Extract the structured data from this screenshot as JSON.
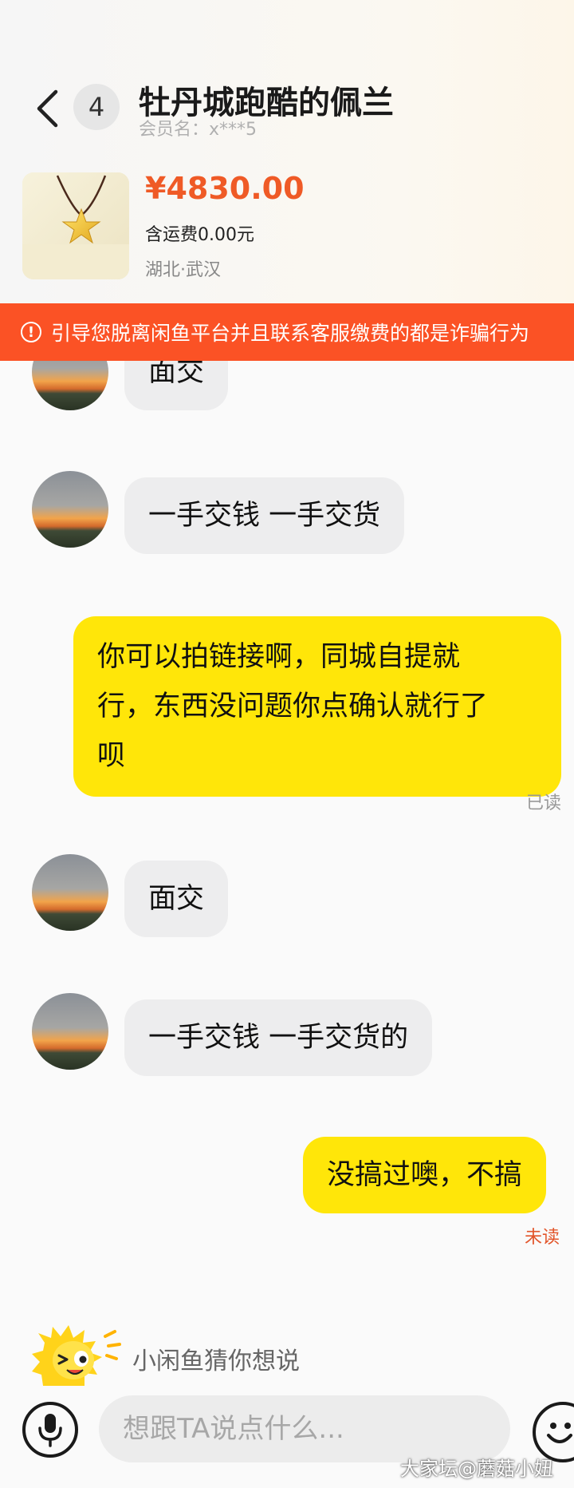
{
  "header": {
    "unread_count": "4",
    "contact_name": "牡丹城跑酷的佩兰",
    "member_label": "会员名：",
    "member_id": "x***5"
  },
  "product": {
    "price": "¥4830.00",
    "shipping": "含运费0.00元",
    "location": "湖北·武汉"
  },
  "warning": {
    "text": "引导您脱离闲鱼平台并且联系客服缴费的都是诈骗行为"
  },
  "messages": [
    {
      "side": "in",
      "text": "面交"
    },
    {
      "side": "in",
      "text": "一手交钱 一手交货"
    },
    {
      "side": "out",
      "lines": [
        "你可以拍链接啊，同城自提就",
        "行，东西没问题你点确认就行了",
        "呗"
      ],
      "receipt": "已读"
    },
    {
      "side": "in",
      "text": "面交"
    },
    {
      "side": "in",
      "text": "一手交钱 一手交货的"
    },
    {
      "side": "out",
      "text": "没搞过噢，不搞",
      "receipt": "未读"
    }
  ],
  "suggest": {
    "text": "小闲鱼猜你想说"
  },
  "input": {
    "placeholder": "想跟TA说点什么..."
  },
  "watermark": "大家坛@蘑菇小妞",
  "colors": {
    "accent_orange": "#fb5225",
    "price_orange": "#ef5a26",
    "outgoing_bubble": "#ffe609",
    "incoming_bubble": "#ededee",
    "unread_receipt": "#e2552a",
    "read_receipt": "#999999"
  },
  "icons": {
    "back": "chevron-left-icon",
    "warning": "exclamation-circle-icon",
    "voice": "microphone-icon",
    "emoji": "smiley-face-icon",
    "mascot": "xianyu-mascot-icon"
  }
}
